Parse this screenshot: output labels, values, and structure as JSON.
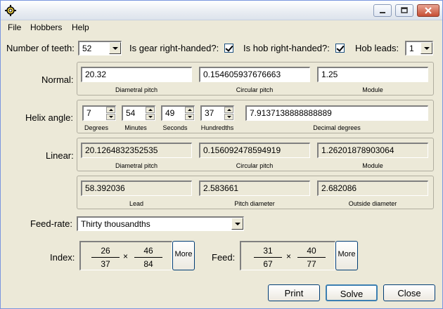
{
  "menu": {
    "file": "File",
    "hobbers": "Hobbers",
    "help": "Help"
  },
  "top_row": {
    "teeth_label": "Number of teeth:",
    "teeth_value": "52",
    "gear_rh_label": "Is gear right-handed?:",
    "gear_rh_checked": true,
    "hob_rh_label": "Is hob right-handed?:",
    "hob_rh_checked": true,
    "hob_leads_label": "Hob leads:",
    "hob_leads_value": "1"
  },
  "normal": {
    "label": "Normal:",
    "diametral_pitch": "20.32",
    "circular_pitch": "0.154605937676663",
    "module": "1.25",
    "caption_dp": "Diametral pitch",
    "caption_cp": "Circular pitch",
    "caption_mod": "Module"
  },
  "helix": {
    "label": "Helix angle:",
    "degrees": "7",
    "minutes": "54",
    "seconds": "49",
    "hundredths": "37",
    "decimal": "7.9137138888888889",
    "caption_deg": "Degrees",
    "caption_min": "Minutes",
    "caption_sec": "Seconds",
    "caption_hun": "Hundredths",
    "caption_dec": "Decimal degrees"
  },
  "linear": {
    "label": "Linear:",
    "diametral_pitch": "20.1264832352535",
    "circular_pitch": "0.156092478594919",
    "module": "1.26201878903064",
    "caption_dp": "Diametral pitch",
    "caption_cp": "Circular pitch",
    "caption_mod": "Module"
  },
  "lead_group": {
    "lead": "58.392036",
    "pitch_diameter": "2.583661",
    "outside_diameter": "2.682086",
    "caption_lead": "Lead",
    "caption_pd": "Pitch diameter",
    "caption_od": "Outside diameter"
  },
  "feed_rate": {
    "label": "Feed-rate:",
    "value": "Thirty thousandths"
  },
  "index": {
    "label": "Index:",
    "f1_num": "26",
    "f1_den": "37",
    "f2_num": "46",
    "f2_den": "84",
    "times": "×",
    "more": "More"
  },
  "feed": {
    "label": "Feed:",
    "f1_num": "31",
    "f1_den": "67",
    "f2_num": "40",
    "f2_den": "77",
    "times": "×",
    "more": "More"
  },
  "buttons": {
    "print": "Print",
    "solve": "Solve",
    "close": "Close"
  }
}
